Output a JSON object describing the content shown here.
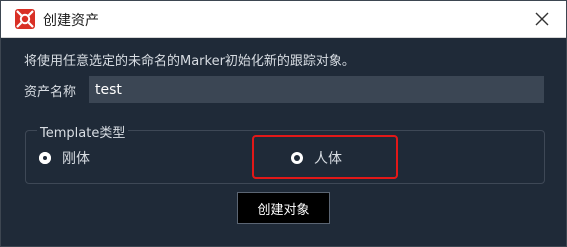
{
  "window": {
    "title": "创建资产",
    "app_icon": "app-logo-icon",
    "close_icon": "close-icon"
  },
  "main": {
    "info_text": "将使用任意选定的未命名的Marker初始化新的跟踪对象。",
    "name_label": "资产名称",
    "name_value": "test",
    "group_title": "Template类型",
    "options": [
      {
        "label": "刚体",
        "selected": false
      },
      {
        "label": "人体",
        "selected": true
      }
    ],
    "create_button": "创建对象"
  },
  "colors": {
    "background": "#1f2a38",
    "input_bg": "#3b4654",
    "highlight": "#e21818",
    "logo": "#d93025"
  }
}
